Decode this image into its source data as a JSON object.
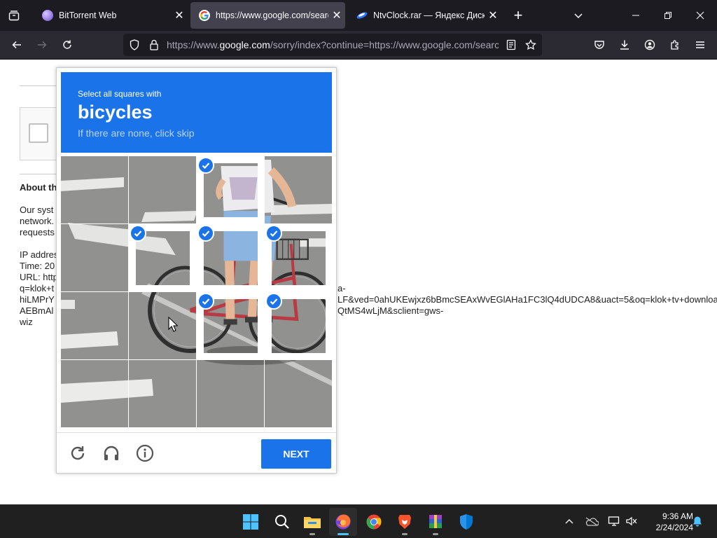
{
  "tabs": [
    {
      "title": "BitTorrent Web",
      "active": false
    },
    {
      "title": "https://www.google.com/search",
      "active": true
    },
    {
      "title": "NtvClock.rar — Яндекс Диск",
      "active": false
    }
  ],
  "url": {
    "prefix": "https://www.",
    "host": "google.com",
    "rest": "/sorry/index?continue=https://www.google.com/search"
  },
  "about": {
    "heading": "About th",
    "lines": [
      "Our syst",
      "network.",
      "requests",
      "",
      "IP addres",
      "Time: 20",
      "URL: http",
      "q=klok+t",
      "hiLMPrY",
      "AEBmAl",
      "wiz"
    ],
    "right1": "a-",
    "right2": "LF&ved=0ahUKEwjxz6bBmcSEAxWvEGlAHa1FC3lQ4dUDCA8&uact=5&oq=klok+tv+download",
    "right3": "QtMS4wLjM&sclient=gws-"
  },
  "captcha": {
    "instruction": "Select all squares with",
    "keyword": "bicycles",
    "hint": "If there are none, click skip",
    "next_label": "NEXT",
    "selected_tiles": [
      2,
      5,
      6,
      7,
      10,
      11
    ],
    "brand_color": "#1a73e8"
  },
  "clock": {
    "time": "9:36 AM",
    "date": "2/24/2024"
  },
  "taskbar_apps": [
    "windows-start",
    "search",
    "file-explorer",
    "firefox",
    "chrome",
    "brave",
    "winrar",
    "windows-security"
  ]
}
